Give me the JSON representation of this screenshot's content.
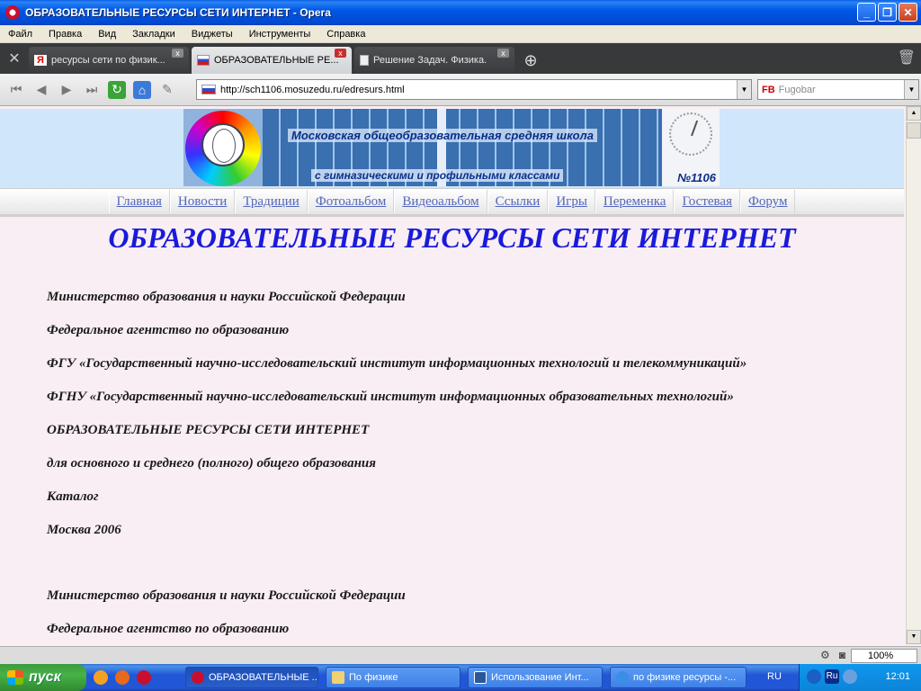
{
  "window": {
    "title": "ОБРАЗОВАТЕЛЬНЫЕ РЕСУРСЫ СЕТИ ИНТЕРНЕТ - Opera",
    "buttons": [
      "_",
      "❐",
      "✕"
    ]
  },
  "menu": [
    "Файл",
    "Правка",
    "Вид",
    "Закладки",
    "Виджеты",
    "Инструменты",
    "Справка"
  ],
  "tabs": [
    {
      "label": "ресурсы сети по физик...",
      "icon": "yandex-icon",
      "active": false
    },
    {
      "label": "ОБРАЗОВАТЕЛЬНЫЕ РЕ...",
      "icon": "flag-icon",
      "active": true
    },
    {
      "label": "Решение Задач. Физика.",
      "icon": "document-icon",
      "active": false
    }
  ],
  "address": {
    "url": "http://sch1106.mosuzedu.ru/edresurs.html",
    "search_placeholder": "Fugobar",
    "search_engine_label": "FB"
  },
  "banner": {
    "line1": "Московская общеобразовательная средняя школа",
    "line2": "с гимназическими и профильными классами",
    "number": "№1106"
  },
  "nav": [
    "Главная",
    "Новости",
    "Традиции",
    "Фотоальбом",
    "Видеоальбом",
    "Ссылки",
    "Игры",
    "Переменка",
    "Гостевая",
    "Форум"
  ],
  "heading": "ОБРАЗОВАТЕЛЬНЫЕ РЕСУРСЫ СЕТИ ИНТЕРНЕТ",
  "paragraphs": [
    "Министерство образования и науки Российской Федерации",
    "Федеральное агентство по образованию",
    "ФГУ «Государственный научно-исследовательский институт информационных технологий и телекоммуникаций»",
    "ФГНУ «Государственный научно-исследовательский институт информационных образовательных технологий»",
    "ОБРАЗОВАТЕЛЬНЫЕ РЕСУРСЫ СЕТИ ИНТЕРНЕТ",
    "для основного и среднего (полного) общего образования",
    "Каталог",
    "Москва 2006"
  ],
  "paragraphs2": [
    "Министерство образования и науки Российской Федерации",
    "Федеральное агентство по образованию"
  ],
  "status": {
    "zoom": "100%"
  },
  "taskbar": {
    "start_label": "пуск",
    "buttons": [
      {
        "label": "ОБРАЗОВАТЕЛЬНЫЕ ...",
        "icon": "opera-icon",
        "active": true
      },
      {
        "label": "По физике",
        "icon": "folder-icon",
        "active": false
      },
      {
        "label": "Использование Инт...",
        "icon": "word-icon",
        "active": false
      },
      {
        "label": "по физике ресурсы -...",
        "icon": "ie-icon",
        "active": false
      }
    ],
    "lang": "RU",
    "tray_lang": "Ru",
    "clock": "12:01"
  }
}
